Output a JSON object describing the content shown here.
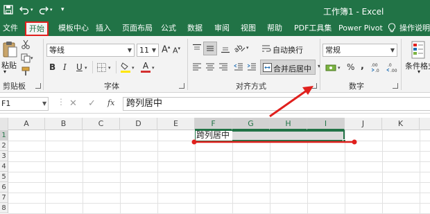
{
  "titlebar": {
    "save_icon": "save-icon",
    "undo_icon": "undo-icon",
    "redo_icon": "redo-icon",
    "customize_icon": "customize-quick-access-icon",
    "title": "工作簿1 - Excel"
  },
  "menu": {
    "tabs": [
      "文件",
      "开始",
      "模板中心",
      "插入",
      "页面布局",
      "公式",
      "数据",
      "审阅",
      "视图",
      "帮助",
      "PDF工具集",
      "Power Pivot"
    ],
    "active_tab": "开始",
    "tell_me": "操作说明搜"
  },
  "ribbon": {
    "clipboard": {
      "paste_label": "粘贴",
      "group_label": "剪贴板"
    },
    "font": {
      "font_name": "等线",
      "font_size": "11",
      "grow_label": "A",
      "shrink_label": "A",
      "bold": "B",
      "italic": "I",
      "underline": "U",
      "font_color_label": "A",
      "group_label": "字体"
    },
    "alignment": {
      "wrap_text": "自动换行",
      "merge_center": "合并后居中",
      "group_label": "对齐方式"
    },
    "number": {
      "format_value": "常规",
      "percent": "%",
      "comma": ",",
      "group_label": "数字"
    },
    "styles": {
      "conditional_format": "条件格式"
    }
  },
  "formula_bar": {
    "name_box": "F1",
    "cancel": "✕",
    "enter": "✓",
    "fx": "fx",
    "content": "跨列居中"
  },
  "grid": {
    "columns": [
      "A",
      "B",
      "C",
      "D",
      "E",
      "F",
      "G",
      "H",
      "I",
      "J",
      "K"
    ],
    "selected_columns": [
      "F",
      "G",
      "H",
      "I"
    ],
    "rows": [
      "1",
      "2",
      "3",
      "4",
      "5",
      "6",
      "7",
      "8"
    ],
    "cell_F1": "跨列居中"
  },
  "colors": {
    "excel_green": "#217346",
    "highlight_red": "#e0201d",
    "font_color_red": "#d32f2f",
    "fill_yellow": "#ffe600"
  }
}
